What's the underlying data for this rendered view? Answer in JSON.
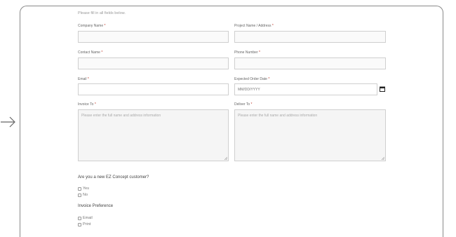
{
  "form": {
    "intro": "Please fill in all fields below.",
    "fields": {
      "company_name": {
        "label": "Company Name",
        "value": ""
      },
      "project_name": {
        "label": "Project Name / Address",
        "value": ""
      },
      "contact_name": {
        "label": "Contact Name",
        "value": ""
      },
      "phone_number": {
        "label": "Phone Number",
        "value": ""
      },
      "email": {
        "label": "Email",
        "value": ""
      },
      "order_date": {
        "label": "Expected Order Date",
        "placeholder": "MM/DD/YYYY"
      },
      "invoice_to": {
        "label": "Invoice To",
        "placeholder": "Please enter the full name and address information"
      },
      "deliver_to": {
        "label": "Deliver To",
        "placeholder": "Please enter the full name and address information"
      }
    },
    "required_mark": "*",
    "new_customer": {
      "question": "Are you a new EZ Concept customer?",
      "options": [
        "Yes",
        "No"
      ]
    },
    "invoice_preference": {
      "question": "Invoice Preference",
      "options": [
        "Email",
        "Print"
      ]
    }
  },
  "icons": {
    "left_arrow": "arrow-right-icon",
    "date_picker": "calendar-icon"
  }
}
